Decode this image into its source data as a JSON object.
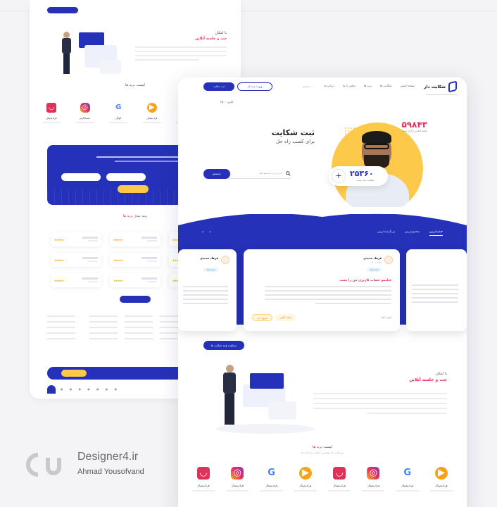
{
  "left": {
    "hero_small": "با امکان",
    "hero_red": "چت و جلسه آنلاین",
    "brands_title_prefix": "لیست",
    "brands_title_red": "برند ها",
    "brands": [
      {
        "name": "فرادیجیتال",
        "icon": "brand-red"
      },
      {
        "name": "اینستاگرام",
        "icon": "instagram"
      },
      {
        "name": "گوگل",
        "icon": "google"
      },
      {
        "name": "فرادیجیتال",
        "icon": "play"
      },
      {
        "name": "فرادیجیتال",
        "icon": "brand-red"
      },
      {
        "name": "اینستاگرام",
        "icon": "instagram"
      }
    ],
    "reviews_title_prefix": "رتبه بندی",
    "reviews_title_red": "برند ها"
  },
  "right": {
    "logo_name": "شکایت دار",
    "menu": [
      "صفحه اصلی",
      "شکایت ها",
      "برند ها",
      "تماس با ما",
      "درباره ما"
    ],
    "search_placeholder": "جستجو ...",
    "btn_outline": "ورود / ثبت نام",
    "btn_fill": "ثبت شکایت",
    "small_stat": "۲۵۰۰ کاربر",
    "hero_title": "ثبت شکایت",
    "hero_subtitle": "برای کسب راه حل",
    "hero_search_placeholder": "نام برند را جستجو کنید",
    "hero_search_button": "جستجو",
    "stat1_value": "۵۹۸۴۳",
    "stat1_label": "جلسه آنلاین برگزار شده",
    "stat2_value": "۲۵۳۶۰",
    "stat2_label": "شکایت ثبت شده",
    "tabs": [
      "جدیدترین",
      "محبوبترین",
      "پربازدیدترین"
    ],
    "card_main": {
      "user": "فرهاد مجیدی",
      "date": "۱۴۰۰/۰۲/۱۶",
      "tag": "فرادیجیتال",
      "title": "فیلیمو حساب کاربری من را بست",
      "btn_meeting": "جلسه آنلاین",
      "btn_chat": "شروع چت",
      "meta": "۱۸۲ بازدید"
    },
    "card_left": {
      "user": "فرهاد مجیدی",
      "tag": "فرادیجیتال"
    },
    "more_button": "مشاهده همه شکایت ها",
    "sec2_small": "با امکان",
    "sec2_red": "چت و جلسه آنلاین",
    "brands_title_prefix": "لیست",
    "brands_title_red": "برند ها",
    "brands_sub": "برند هایی که بیشترین شکایت را داشته اند",
    "brands": [
      {
        "name": "فرادیجیتال",
        "icon": "brand-red"
      },
      {
        "name": "فرادیجیتال",
        "icon": "instagram"
      },
      {
        "name": "فرادیجیتال",
        "icon": "google"
      },
      {
        "name": "فرادیجیتال",
        "icon": "play"
      },
      {
        "name": "فرادیجیتال",
        "icon": "brand-red"
      },
      {
        "name": "فرادیجیتال",
        "icon": "instagram"
      },
      {
        "name": "فرادیجیتال",
        "icon": "google"
      },
      {
        "name": "فرادیجیتال",
        "icon": "play"
      }
    ]
  },
  "watermark": {
    "site": "Designer4.ir",
    "author": "Ahmad Yousofvand"
  },
  "colors": {
    "primary": "#2531b8",
    "accent_red": "#e0315a",
    "accent_yellow": "#fcc94b"
  }
}
